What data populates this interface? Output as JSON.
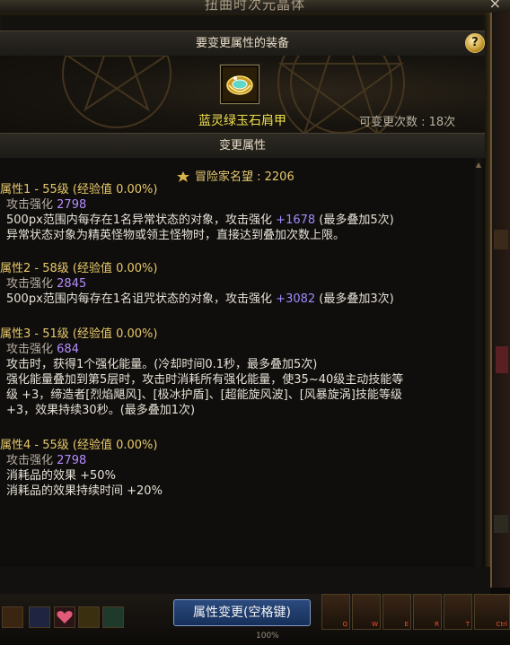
{
  "window": {
    "title": "扭曲时次元晶体",
    "close_label": "×"
  },
  "equip_section": {
    "header": "要变更属性的装备",
    "help_label": "?",
    "item_name": "蓝灵绿玉石肩甲",
    "change_count": "可变更次数 : 18次"
  },
  "change_section": {
    "header": "变更属性",
    "fame": "冒险家名望 : 2206"
  },
  "properties": [
    {
      "title": "属性1 - 55级 (经验值 0.00%)",
      "stat_label": "攻击强化",
      "stat_value": "2798",
      "lines": [
        {
          "pre": "500px范围内每存在1名异常状态的对象，攻击强化 ",
          "hl": "+1678",
          "post": " (最多叠加5次)"
        },
        {
          "pre": "异常状态对象为精英怪物或领主怪物时，直接达到叠加次数上限。",
          "hl": "",
          "post": ""
        }
      ]
    },
    {
      "title": "属性2 - 58级 (经验值 0.00%)",
      "stat_label": "攻击强化",
      "stat_value": "2845",
      "lines": [
        {
          "pre": "500px范围内每存在1名诅咒状态的对象，攻击强化 ",
          "hl": "+3082",
          "post": " (最多叠加3次)"
        }
      ]
    },
    {
      "title": "属性3 - 51级 (经验值 0.00%)",
      "stat_label": "攻击强化",
      "stat_value": "684",
      "lines": [
        {
          "pre": "攻击时，获得1个强化能量。(冷却时间0.1秒，最多叠加5次)",
          "hl": "",
          "post": ""
        },
        {
          "pre": "强化能量叠加到第5层时，攻击时消耗所有强化能量，使35~40级主动技能等",
          "hl": "",
          "post": ""
        },
        {
          "pre": "级 +3，缔造者[烈焰飓风]、[极冰护盾]、[超能旋风波]、[风暴旋涡]技能等级",
          "hl": "",
          "post": ""
        },
        {
          "pre": "+3，效果持续30秒。(最多叠加1次)",
          "hl": "",
          "post": ""
        }
      ]
    },
    {
      "title": "属性4 - 55级 (经验值 0.00%)",
      "stat_label": "攻击强化",
      "stat_value": "2798",
      "lines": [
        {
          "pre": "消耗品的效果 +50%",
          "hl": "",
          "post": ""
        },
        {
          "pre": "消耗品的效果持续时间 +20%",
          "hl": "",
          "post": ""
        }
      ]
    }
  ],
  "footer": {
    "change_button": "属性变更(空格键)",
    "hud_percent": "100%",
    "skill_keys": [
      "Q",
      "W",
      "E",
      "R",
      "T",
      "Ctrl"
    ]
  },
  "colors": {
    "property_title": "#e8c86a",
    "stat_value": "#b58cff",
    "item_name": "#f0e04a",
    "button": "#2b4a7e"
  }
}
